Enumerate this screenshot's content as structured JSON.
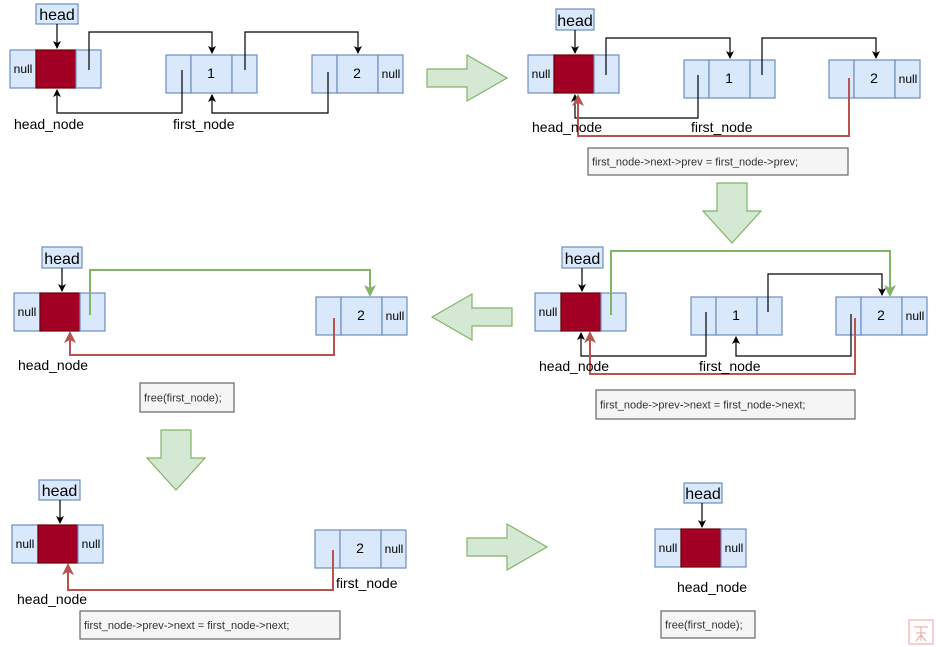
{
  "labels": {
    "head": "head",
    "null": "null",
    "head_node": "head_node",
    "first_node": "first_node",
    "one": "1",
    "two": "2"
  },
  "code": {
    "step1": "first_node->next->prev = first_node->prev;",
    "step2": "first_node->prev->next = first_node->next;",
    "free": "free(first_node);",
    "step5": "first_node->prev->next = first_node->next;",
    "free_final": "free(first_node);"
  },
  "colors": {
    "node_fill": "#dae8fc",
    "node_stroke": "#6c8ebf",
    "head_node_fill": "#a20025",
    "new_link_green": "#82b366",
    "new_link_red": "#b85450",
    "flow_arrow_fill": "#d5e8d4"
  },
  "watermark": "seal"
}
